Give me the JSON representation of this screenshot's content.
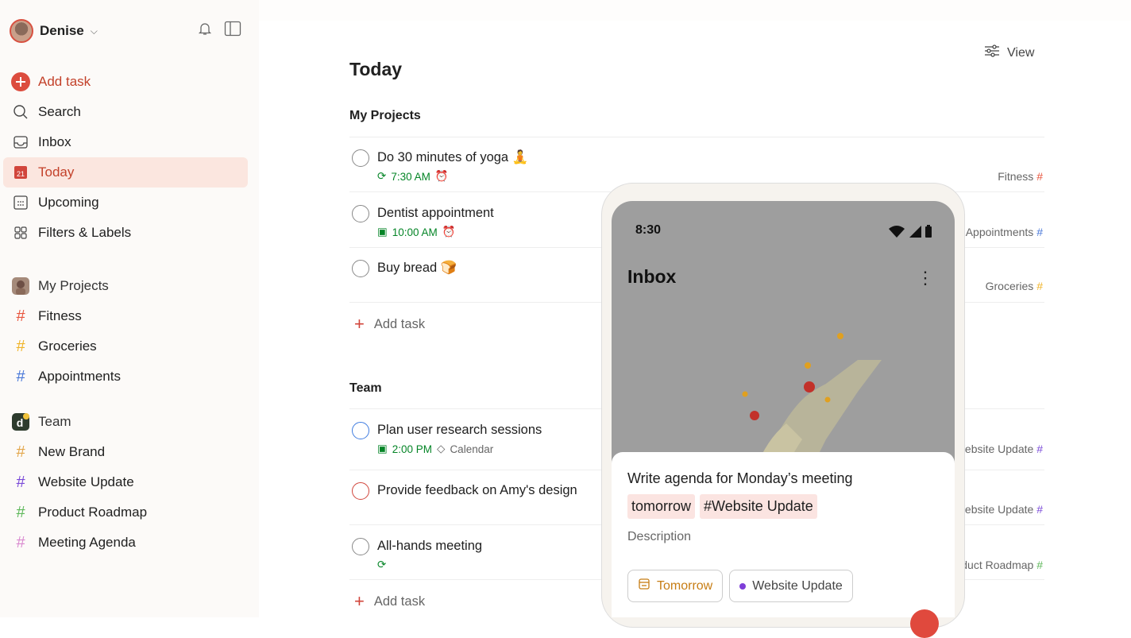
{
  "sidebar": {
    "user_name": "Denise",
    "nav": [
      {
        "label": "Add task",
        "icon": "plus-circle-icon"
      },
      {
        "label": "Search",
        "icon": "search-icon"
      },
      {
        "label": "Inbox",
        "icon": "inbox-icon"
      },
      {
        "label": "Today",
        "icon": "calendar-today-icon",
        "day": "21"
      },
      {
        "label": "Upcoming",
        "icon": "calendar-grid-icon"
      },
      {
        "label": "Filters & Labels",
        "icon": "filters-icon"
      }
    ],
    "my_projects": {
      "label": "My Projects",
      "items": [
        {
          "label": "Fitness",
          "color": "#e8553d"
        },
        {
          "label": "Groceries",
          "color": "#f0b429"
        },
        {
          "label": "Appointments",
          "color": "#4a78d8"
        }
      ]
    },
    "team": {
      "label": "Team",
      "badge": "d",
      "items": [
        {
          "label": "New Brand",
          "color": "#e3a64b"
        },
        {
          "label": "Website Update",
          "color": "#7a4ad8"
        },
        {
          "label": "Product Roadmap",
          "color": "#5fb85b"
        },
        {
          "label": "Meeting Agenda",
          "color": "#d98ad0"
        }
      ]
    }
  },
  "main": {
    "title": "Today",
    "view_label": "View",
    "groups": [
      {
        "title": "My Projects",
        "tasks": [
          {
            "name": "Do 30 minutes of yoga 🧘",
            "time": "7:30 AM",
            "project": "Fitness",
            "hash_color": "#e8553d"
          },
          {
            "name": "Dentist appointment",
            "time": "10:00 AM",
            "project": "Appointments",
            "hash_color": "#4a78d8"
          },
          {
            "name": "Buy bread 🍞",
            "time": "",
            "project": "Groceries",
            "hash_color": "#f0b429"
          }
        ],
        "add_label": "Add task"
      },
      {
        "title": "Team",
        "tasks": [
          {
            "name": "Plan user research sessions",
            "time": "2:00 PM",
            "extra": "Calendar",
            "project": "Website Update",
            "hash_color": "#7a4ad8"
          },
          {
            "name": "Provide feedback on Amy's design",
            "time": "",
            "project": "Website Update",
            "hash_color": "#7a4ad8"
          },
          {
            "name": "All-hands meeting",
            "time": "",
            "project": "Product Roadmap",
            "hash_color": "#5fb85b"
          }
        ],
        "add_label": "Add task"
      }
    ]
  },
  "phone": {
    "time": "8:30",
    "title": "Inbox",
    "sheet": {
      "title": "Write agenda for Monday’s meeting",
      "chip_date": "tomorrow",
      "chip_project": "#Website Update",
      "description_placeholder": "Description",
      "date_pill": "Tomorrow",
      "project_pill": "Website Update"
    }
  }
}
